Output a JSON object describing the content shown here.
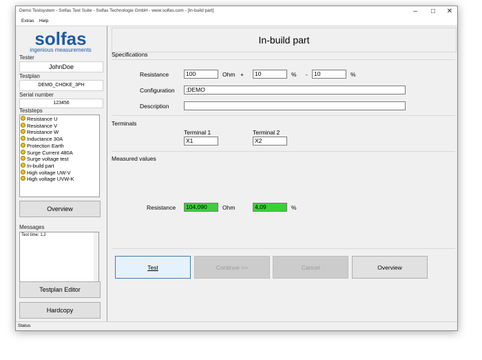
{
  "window": {
    "title": "Demo Testsystem - Solfas Test Suite - Solfas Technologie GmbH - www.solfas.com - [In-build part]",
    "minimize_icon": "minimize-icon",
    "maximize_icon": "maximize-icon",
    "close_icon": "close-icon"
  },
  "menu": {
    "extras": "Extras",
    "help": "Help"
  },
  "logo": {
    "brand": "solfas",
    "tagline": "ingenious measurements",
    "color": "#1f5aa6"
  },
  "sidebar": {
    "tester_label": "Tester",
    "tester_value": "JohnDoe",
    "testplan_label": "Testplan",
    "testplan_value": "DEMO_CHOKE_3PH",
    "serial_label": "Serial number",
    "serial_value": "123456",
    "teststeps_label": "Teststeps",
    "teststeps": [
      "Resistance U",
      "Resistance V",
      "Resistance W",
      "Inductance 30A",
      "Protection Earth",
      "Surge Current 480A",
      "Surge voltage test",
      "In-build part",
      "High voltage UW-V",
      "High voltage UVW-K"
    ],
    "overview_button": "Overview",
    "messages_label": "Messages",
    "messages_text": "Test time: 1,2",
    "testplan_editor_button": "Testplan Editor",
    "hardcopy_button": "Hardcopy"
  },
  "main": {
    "heading": "In-build part",
    "specifications": {
      "section_label": "Specifications",
      "resistance_label": "Resistance",
      "resistance_value": "100",
      "resistance_unit": "Ohm",
      "plus_sign": "+",
      "tol_plus": "10",
      "pct1": "%",
      "minus_sign": "-",
      "tol_minus": "10",
      "pct2": "%",
      "configuration_label": "Configuration",
      "configuration_value": ";DEMO",
      "description_label": "Description",
      "description_value": ""
    },
    "terminals": {
      "section_label": "Terminals",
      "terminal1_label": "Terminal 1",
      "terminal1_value": "X1",
      "terminal2_label": "Terminal 2",
      "terminal2_value": "X2"
    },
    "measured": {
      "section_label": "Measured values",
      "resistance_label": "Resistance",
      "resistance_value": "104,090",
      "resistance_unit": "Ohm",
      "deviation_value": "4,09",
      "deviation_unit": "%",
      "pass_color": "#3ccf3c"
    },
    "buttons": {
      "test": "Test",
      "continue": "Continue >>",
      "cancel": "Cancel",
      "overview": "Overview"
    }
  },
  "statusbar": {
    "text": "Status"
  }
}
